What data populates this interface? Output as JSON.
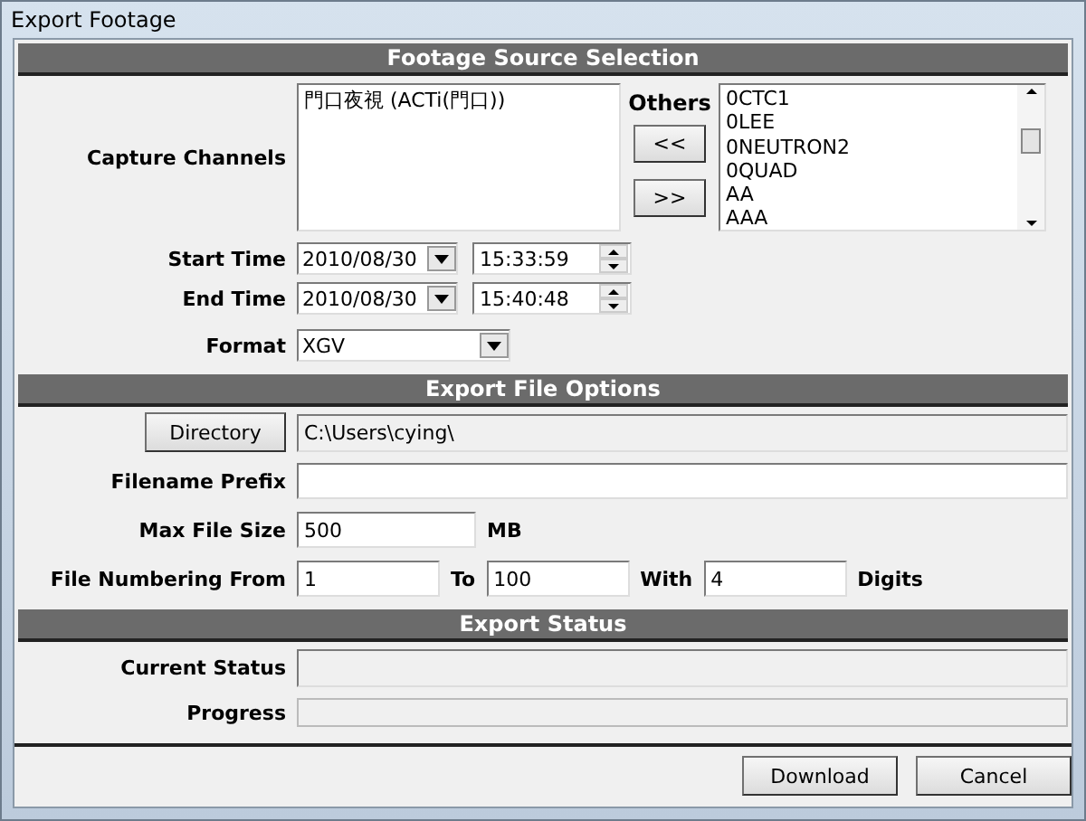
{
  "window": {
    "title": "Export Footage"
  },
  "source_section": {
    "title": "Footage Source Selection",
    "capture_channels": {
      "label": "Capture Channels",
      "items": [
        "門口夜視 (ACTi(門口))"
      ]
    },
    "others": {
      "label": "Others",
      "add_button": "<<",
      "remove_button": ">>",
      "items": [
        "0CTC1",
        "0LEE",
        "0NEUTRON2",
        "0QUAD",
        "AA",
        "AAA"
      ]
    },
    "start_time": {
      "label": "Start Time",
      "date": "2010/08/30",
      "time": "15:33:59"
    },
    "end_time": {
      "label": "End Time",
      "date": "2010/08/30",
      "time": "15:40:48"
    },
    "format": {
      "label": "Format",
      "value": "XGV"
    }
  },
  "file_section": {
    "title": "Export File Options",
    "directory": {
      "button": "Directory",
      "value": "C:\\Users\\cying\\"
    },
    "filename_prefix": {
      "label": "Filename Prefix"
    },
    "max_file_size": {
      "label": "Max File Size",
      "value": "500",
      "unit": "MB"
    },
    "numbering": {
      "label": "File Numbering From",
      "from": "1",
      "to_label": "To",
      "to": "100",
      "with_label": "With",
      "digits": "4",
      "digits_label": "Digits"
    }
  },
  "status_section": {
    "title": "Export Status",
    "current_status": {
      "label": "Current Status"
    },
    "progress": {
      "label": "Progress",
      "level": 0
    }
  },
  "buttons": [
    "Download",
    "Cancel"
  ]
}
